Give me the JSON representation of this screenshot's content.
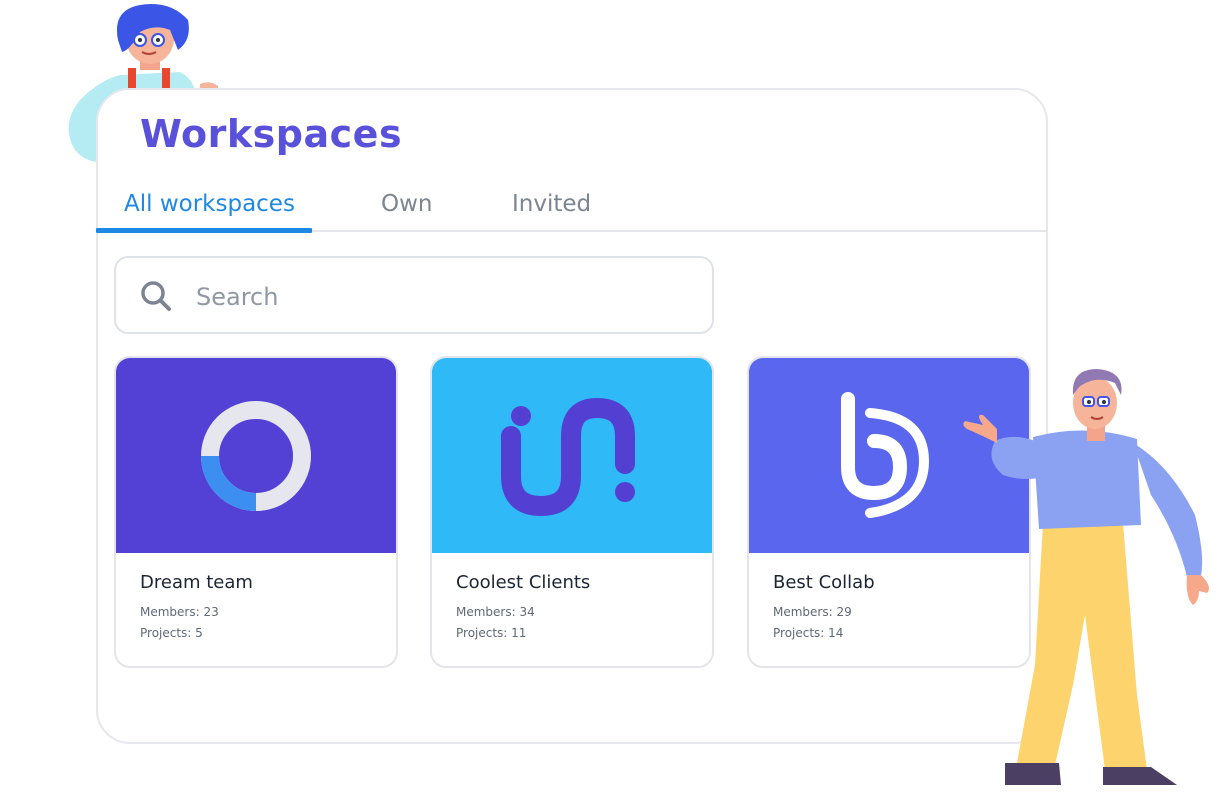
{
  "page": {
    "title": "Workspaces"
  },
  "tabs": [
    {
      "label": "All workspaces",
      "active": true
    },
    {
      "label": "Own",
      "active": false
    },
    {
      "label": "Invited",
      "active": false
    }
  ],
  "search": {
    "placeholder": "Search",
    "value": ""
  },
  "workspaces": [
    {
      "name": "Dream team",
      "members_label": "Members: 23",
      "projects_label": "Projects: 5",
      "color": "#5341d6",
      "logo": "ring-logo-icon"
    },
    {
      "name": "Coolest Clients",
      "members_label": "Members: 34",
      "projects_label": "Projects: 11",
      "color": "#30b9f7",
      "logo": "in-logo-icon"
    },
    {
      "name": "Best Collab",
      "members_label": "Members: 29",
      "projects_label": "Projects: 14",
      "color": "#5a66ee",
      "logo": "b-logo-icon"
    }
  ],
  "colors": {
    "accent": "#1e88e5",
    "title": "#5a51db",
    "border": "#e3e5ea"
  }
}
